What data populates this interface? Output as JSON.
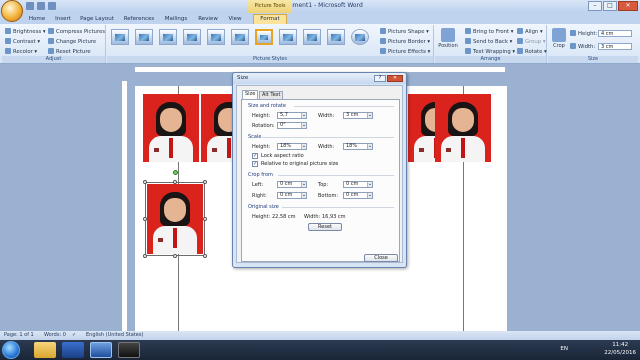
{
  "window": {
    "title": "Document1 - Microsoft Word",
    "context_tab_title": "Picture Tools",
    "min": "–",
    "max": "□",
    "close": "✕"
  },
  "tabs": [
    "Home",
    "Insert",
    "Page Layout",
    "References",
    "Mailings",
    "Review",
    "View",
    "Format"
  ],
  "active_tab": "Format",
  "ribbon": {
    "adjust": {
      "label": "Adjust",
      "brightness": "Brightness",
      "contrast": "Contrast",
      "recolor": "Recolor",
      "compress": "Compress Pictures",
      "change": "Change Picture",
      "reset": "Reset Picture"
    },
    "styles": {
      "label": "Picture Styles",
      "shape": "Picture Shape",
      "border": "Picture Border",
      "effects": "Picture Effects"
    },
    "arrange": {
      "label": "Arrange",
      "position": "Position",
      "front": "Bring to Front",
      "back": "Send to Back",
      "wrap": "Text Wrapping",
      "align": "Align",
      "group": "Group",
      "rotate": "Rotate"
    },
    "size": {
      "label": "Size",
      "crop": "Crop",
      "height_label": "Height:",
      "height": "4 cm",
      "width_label": "Width:",
      "width": "3 cm"
    }
  },
  "dialog": {
    "title": "Size",
    "tab_size": "Size",
    "tab_alt": "Alt Text",
    "size_rotate": "Size and rotate",
    "height_label": "Height:",
    "height": "5,7",
    "width_label": "Width:",
    "width": "3 cm",
    "rotation_label": "Rotation:",
    "rotation": "0°",
    "scale": "Scale",
    "scale_height": "18%",
    "scale_width": "18%",
    "lock_aspect": "Lock aspect ratio",
    "relative": "Relative to original picture size",
    "crop_from": "Crop from",
    "left_label": "Left:",
    "left": "0 cm",
    "top_label": "Top:",
    "top": "0 cm",
    "right_label": "Right:",
    "right": "0 cm",
    "bottom_label": "Bottom:",
    "bottom": "0 cm",
    "original_size": "Original size",
    "orig_height_label": "Height:",
    "orig_height": "22,58 cm",
    "orig_width_label": "Width:",
    "orig_width": "16,93 cm",
    "reset": "Reset",
    "close": "Close"
  },
  "status": {
    "page": "Page: 1 of 1",
    "words": "Words: 0",
    "language": "English (United States)"
  },
  "taskbar": {
    "lang": "EN",
    "time": "11:42",
    "date": "22/05/2016"
  },
  "icons": {
    "office": "office-orb-icon",
    "start": "windows-start-icon"
  }
}
